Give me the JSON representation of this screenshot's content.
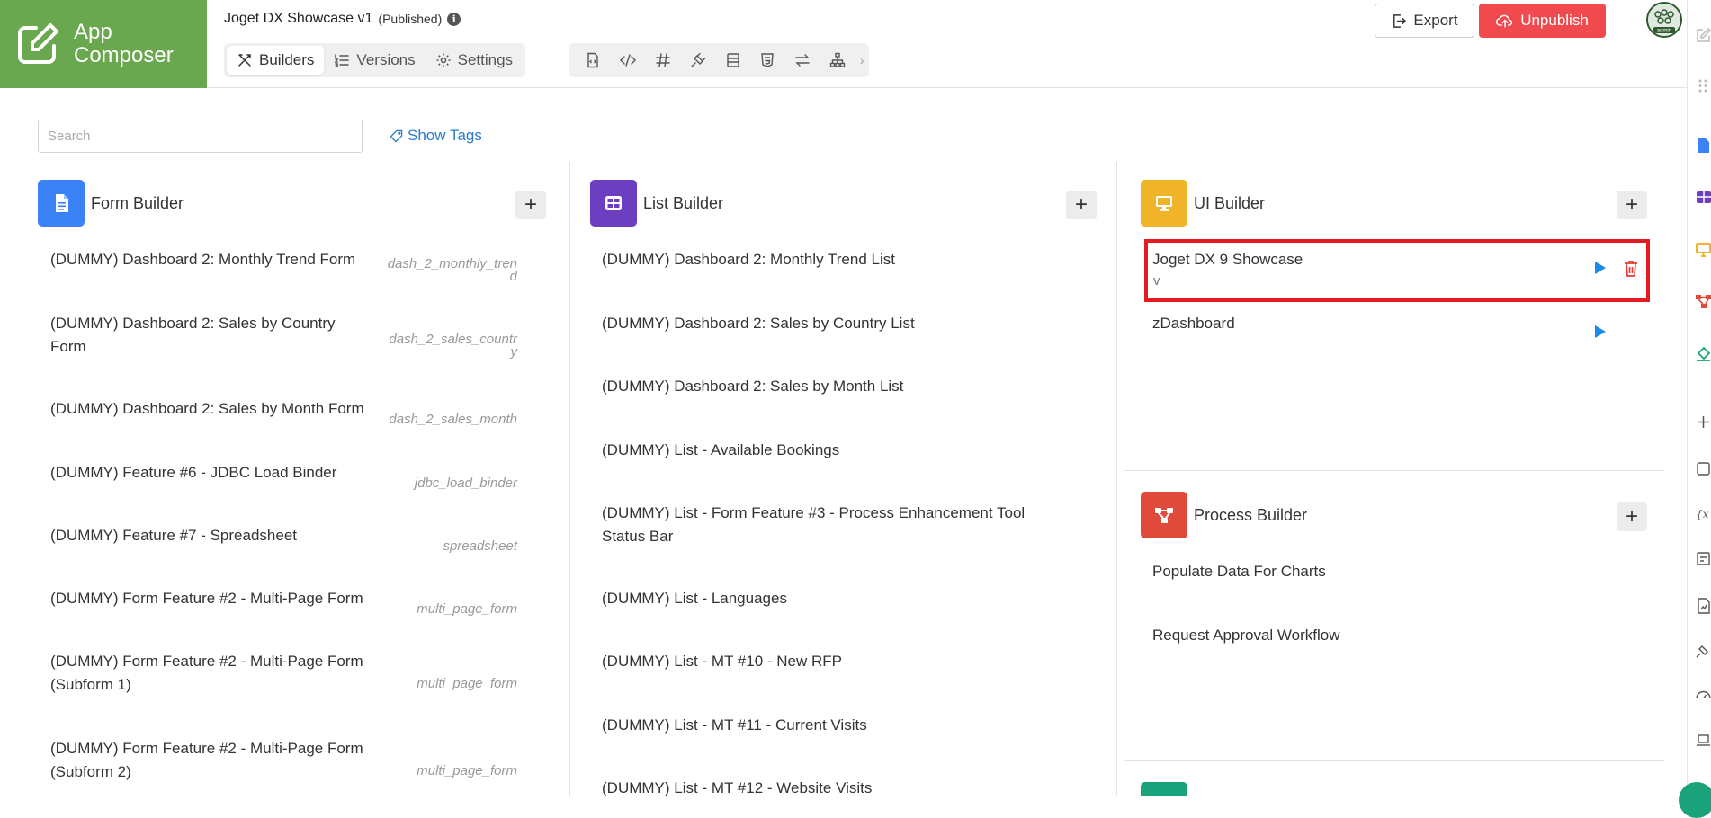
{
  "header": {
    "logo_text_line1": "App",
    "logo_text_line2": "Composer",
    "app_name": "Joget DX Showcase v1",
    "app_status": "(Published)",
    "tabs": [
      {
        "label": "Builders"
      },
      {
        "label": "Versions"
      },
      {
        "label": "Settings"
      }
    ],
    "export_label": "Export",
    "unpublish_label": "Unpublish",
    "avatar_text": "admin"
  },
  "search": {
    "placeholder": "Search",
    "show_tags_label": "Show Tags"
  },
  "form_builder": {
    "title": "Form Builder",
    "items": [
      {
        "label_1": "(DUMMY) Dashboard 2: Monthly Trend Form",
        "label_2": "",
        "id_1": "dash_2_monthly_tren",
        "id_2": "d"
      },
      {
        "label_1": "(DUMMY) Dashboard 2: Sales by Country",
        "label_2": "Form",
        "id_1": "dash_2_sales_countr",
        "id_2": "y"
      },
      {
        "label_1": "(DUMMY) Dashboard 2: Sales by Month Form",
        "label_2": "",
        "id_1": "dash_2_sales_month",
        "id_2": ""
      },
      {
        "label_1": "(DUMMY) Feature #6 - JDBC Load Binder",
        "label_2": "",
        "id_1": "jdbc_load_binder",
        "id_2": ""
      },
      {
        "label_1": "(DUMMY) Feature #7 - Spreadsheet",
        "label_2": "",
        "id_1": "spreadsheet",
        "id_2": ""
      },
      {
        "label_1": "(DUMMY) Form Feature #2 - Multi-Page Form",
        "label_2": "",
        "id_1": "multi_page_form",
        "id_2": ""
      },
      {
        "label_1": "(DUMMY) Form Feature #2 - Multi-Page Form",
        "label_2": "(Subform 1)",
        "id_1": "multi_page_form",
        "id_2": ""
      },
      {
        "label_1": "(DUMMY) Form Feature #2 - Multi-Page Form",
        "label_2": "(Subform 2)",
        "id_1": "multi_page_form",
        "id_2": ""
      }
    ]
  },
  "list_builder": {
    "title": "List Builder",
    "items": [
      {
        "label_1": "(DUMMY) Dashboard 2: Monthly Trend List",
        "label_2": ""
      },
      {
        "label_1": "(DUMMY) Dashboard 2: Sales by Country List",
        "label_2": ""
      },
      {
        "label_1": "(DUMMY) Dashboard 2: Sales by Month List",
        "label_2": ""
      },
      {
        "label_1": "(DUMMY) List - Available Bookings",
        "label_2": ""
      },
      {
        "label_1": "(DUMMY) List - Form Feature #3 - Process Enhancement Tool",
        "label_2": "Status Bar"
      },
      {
        "label_1": "(DUMMY) List - Languages",
        "label_2": ""
      },
      {
        "label_1": "(DUMMY) List - MT #10 - New RFP",
        "label_2": ""
      },
      {
        "label_1": "(DUMMY) List - MT #11 - Current Visits",
        "label_2": ""
      },
      {
        "label_1": "(DUMMY) List - MT #12 - Website Visits",
        "label_2": ""
      }
    ]
  },
  "ui_builder": {
    "title": "UI Builder",
    "items": [
      {
        "label": "Joget DX 9 Showcase",
        "sub": "v"
      },
      {
        "label": "zDashboard",
        "sub": ""
      }
    ]
  },
  "process_builder": {
    "title": "Process Builder",
    "items": [
      {
        "label": "Populate Data For Charts"
      },
      {
        "label": "Request Approval Workflow"
      }
    ]
  },
  "colors": {
    "brand": "#6aa84f",
    "form_icon": "#3b82f6",
    "list_icon": "#6b3fbf",
    "ui_icon": "#f0b429",
    "process_icon": "#e04a3a",
    "play": "#1e88e5",
    "delete": "#e53935",
    "highlight": "#e31b23"
  }
}
